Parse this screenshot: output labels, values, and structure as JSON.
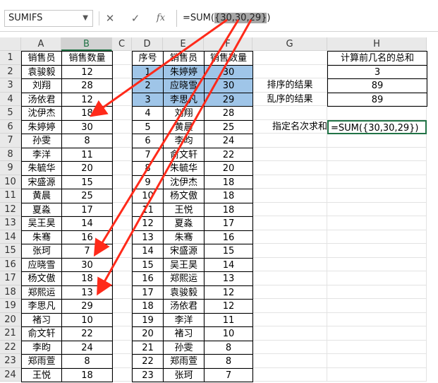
{
  "formula_bar": {
    "name_box": "SUMIFS",
    "cancel_glyph": "✕",
    "enter_glyph": "✓",
    "fx_glyph": "fx",
    "formula_prefix": "=SUM(",
    "formula_highlight": "{30,30,29}",
    "formula_suffix": ")"
  },
  "columns": [
    "A",
    "B",
    "C",
    "D",
    "E",
    "F",
    "G",
    "H"
  ],
  "selected_column": "B",
  "rows": [
    "1",
    "2",
    "3",
    "4",
    "5",
    "6",
    "7",
    "8",
    "9",
    "10",
    "11",
    "12",
    "13",
    "14",
    "15",
    "16",
    "17",
    "18",
    "19",
    "20",
    "21",
    "22",
    "23",
    "24"
  ],
  "table_ab": {
    "header": [
      "销售员",
      "销售数量"
    ],
    "rows": [
      [
        "袁骏毅",
        "12"
      ],
      [
        "刘翔",
        "28"
      ],
      [
        "汤依君",
        "12"
      ],
      [
        "沈伊杰",
        "18"
      ],
      [
        "朱婷婷",
        "30"
      ],
      [
        "孙雯",
        "8"
      ],
      [
        "李洋",
        "11"
      ],
      [
        "朱毓华",
        "20"
      ],
      [
        "宋盛源",
        "15"
      ],
      [
        "黄晨",
        "25"
      ],
      [
        "夏淼",
        "17"
      ],
      [
        "吴王昊",
        "14"
      ],
      [
        "朱骞",
        "16"
      ],
      [
        "张珂",
        "7"
      ],
      [
        "应晓雪",
        "30"
      ],
      [
        "杨文傲",
        "18"
      ],
      [
        "郑熙运",
        "13"
      ],
      [
        "李思凡",
        "29"
      ],
      [
        "褚习",
        "10"
      ],
      [
        "俞文轩",
        "22"
      ],
      [
        "李昀",
        "24"
      ],
      [
        "郑雨萱",
        "8"
      ],
      [
        "王悦",
        "18"
      ]
    ]
  },
  "table_def": {
    "header": [
      "序号",
      "销售员",
      "销售数量"
    ],
    "rows": [
      [
        "1",
        "朱婷婷",
        "30"
      ],
      [
        "2",
        "应晓雪",
        "30"
      ],
      [
        "3",
        "李思凡",
        "29"
      ],
      [
        "4",
        "刘翔",
        "28"
      ],
      [
        "5",
        "黄晨",
        "25"
      ],
      [
        "6",
        "李昀",
        "24"
      ],
      [
        "7",
        "俞文轩",
        "22"
      ],
      [
        "8",
        "朱毓华",
        "20"
      ],
      [
        "9",
        "沈伊杰",
        "18"
      ],
      [
        "10",
        "杨文傲",
        "18"
      ],
      [
        "11",
        "王悦",
        "18"
      ],
      [
        "12",
        "夏淼",
        "17"
      ],
      [
        "13",
        "朱骞",
        "16"
      ],
      [
        "14",
        "宋盛源",
        "15"
      ],
      [
        "15",
        "吴王昊",
        "14"
      ],
      [
        "16",
        "郑熙运",
        "13"
      ],
      [
        "17",
        "袁骏毅",
        "12"
      ],
      [
        "18",
        "汤依君",
        "12"
      ],
      [
        "19",
        "李洋",
        "11"
      ],
      [
        "20",
        "褚习",
        "10"
      ],
      [
        "21",
        "孙雯",
        "8"
      ],
      [
        "22",
        "郑雨萱",
        "8"
      ],
      [
        "23",
        "张珂",
        "7"
      ]
    ],
    "highlight_rows": 3,
    "highlight_color": "#9fc5e8"
  },
  "gh_panel": {
    "h1": "计算前几名的总和",
    "h2": "3",
    "g3": "排序的结果",
    "h3": "89",
    "g4": "乱序的结果",
    "h4": "89",
    "g6": "指定名次求和",
    "h6": "=SUM({30,30,29})"
  },
  "colors": {
    "arrow": "#ff2a1a",
    "accent": "#217346"
  }
}
